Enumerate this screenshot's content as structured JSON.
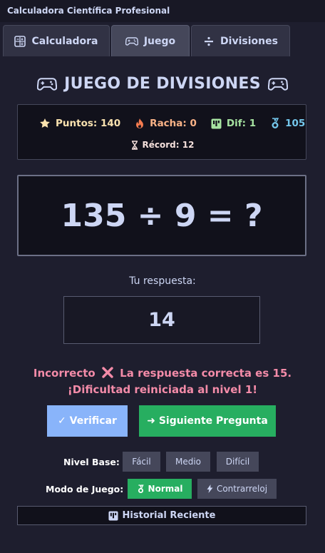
{
  "window": {
    "title": "Calculadora Científica Profesional"
  },
  "tabs": [
    {
      "label": "Calculadora",
      "icon": "calculator-icon",
      "active": false
    },
    {
      "label": "Juego",
      "icon": "gamepad-icon",
      "active": true
    },
    {
      "label": "Divisiones",
      "icon": "divide-icon",
      "active": false
    }
  ],
  "game": {
    "title": "JUEGO DE DIVISIONES",
    "stats": {
      "points": "Puntos: 140",
      "streak": "Racha: 0",
      "difficulty": "Dif: 1",
      "count": "105",
      "record": "Récord: 12"
    },
    "problem": "135 ÷ 9 = ?",
    "answer_label": "Tu respuesta:",
    "answer_value": "14",
    "feedback_prefix": "Incorrecto",
    "feedback_text": "La respuesta correcta es 15. ¡Dificultad reiniciada al nivel 1!",
    "verify_label": "✓ Verificar",
    "next_label": "➜ Siguiente Pregunta",
    "level_label": "Nivel Base:",
    "levels": [
      "Fácil",
      "Medio",
      "Difícil"
    ],
    "mode_label": "Modo de Juego:",
    "modes": [
      {
        "label": "Normal",
        "active": true
      },
      {
        "label": "Contrarreloj",
        "active": false
      }
    ],
    "history_label": "Historial Reciente"
  },
  "colors": {
    "background": "#1e1e2e",
    "accent_green": "#27ae60",
    "accent_blue": "#89b4fa",
    "error": "#f38ba8",
    "points": "#f9e2af",
    "streak": "#fab387",
    "difficulty": "#a6e3a1",
    "count": "#74c7ec"
  }
}
